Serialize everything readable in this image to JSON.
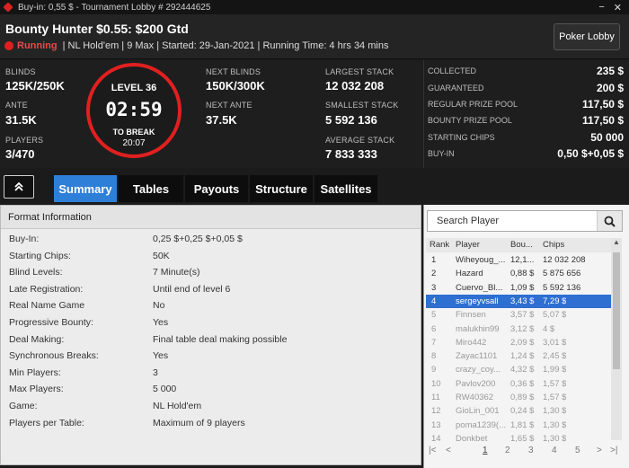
{
  "window": {
    "title": "Buy-in: 0,55 $ - Tournament Lobby # 292444625",
    "controls": [
      "−",
      "✕"
    ]
  },
  "header": {
    "tournament_name": "Bounty Hunter $0.55: $200 Gtd",
    "status": "Running",
    "details": "| NL Hold'em | 9 Max | Started: 29-Jan-2021 | Running Time: 4 hrs  34 mins",
    "lobby_button": "Poker Lobby"
  },
  "stats": {
    "blinds_label": "BLINDS",
    "blinds": "125K/250K",
    "ante_label": "ANTE",
    "ante": "31.5K",
    "players_label": "PLAYERS",
    "players": "3/470",
    "next_blinds_label": "NEXT BLINDS",
    "next_blinds": "150K/300K",
    "next_ante_label": "NEXT ANTE",
    "next_ante": "37.5K",
    "largest_stack_label": "LARGEST STACK",
    "largest_stack": "12 032 208",
    "smallest_stack_label": "SMALLEST STACK",
    "smallest_stack": "5 592 136",
    "average_stack_label": "AVERAGE STACK",
    "average_stack": "7 833 333"
  },
  "clock": {
    "level": "LEVEL 36",
    "time": "02:59",
    "to_break_label": "TO BREAK",
    "to_break": "20:07"
  },
  "prize": [
    {
      "label": "COLLECTED",
      "value": "235 $"
    },
    {
      "label": "GUARANTEED",
      "value": "200 $"
    },
    {
      "label": "REGULAR PRIZE POOL",
      "value": "117,50 $"
    },
    {
      "label": "BOUNTY PRIZE POOL",
      "value": "117,50 $"
    },
    {
      "label": "STARTING CHIPS",
      "value": "50 000"
    },
    {
      "label": "BUY-IN",
      "value": "0,50 $+0,05 $"
    }
  ],
  "tabs": [
    {
      "label": "Summary",
      "active": true
    },
    {
      "label": "Tables"
    },
    {
      "label": "Payouts"
    },
    {
      "label": "Structure"
    },
    {
      "label": "Satellites"
    }
  ],
  "format": {
    "heading": "Format Information",
    "rows": [
      {
        "label": "Buy-In:",
        "value": "0,25 $+0,25 $+0,05 $"
      },
      {
        "label": "Starting Chips:",
        "value": "50K"
      },
      {
        "label": "Blind Levels:",
        "value": "7 Minute(s)"
      },
      {
        "label": "Late Registration:",
        "value": "Until end of level 6"
      },
      {
        "label": "Real Name Game",
        "value": "No"
      },
      {
        "label": "Progressive Bounty:",
        "value": "Yes"
      },
      {
        "label": "Deal Making:",
        "value": "Final table deal making possible"
      },
      {
        "label": "Synchronous Breaks:",
        "value": "Yes"
      },
      {
        "label": "Min Players:",
        "value": "3"
      },
      {
        "label": "Max Players:",
        "value": "5 000"
      },
      {
        "label": "Game:",
        "value": "NL Hold'em"
      },
      {
        "label": "Players per Table:",
        "value": "Maximum of 9 players"
      }
    ]
  },
  "players": {
    "search_placeholder": "Search Player",
    "columns": [
      "Rank",
      "Player",
      "Bou...",
      "Chips"
    ],
    "rows": [
      {
        "rank": "1",
        "player": "Wiheyoug_...",
        "bounty": "12,1...",
        "chips": "12 032 208",
        "state": "normal"
      },
      {
        "rank": "2",
        "player": "Hazard",
        "bounty": "0,88 $",
        "chips": "5 875 656",
        "state": "normal"
      },
      {
        "rank": "3",
        "player": "Cuervo_Bl...",
        "bounty": "1,09 $",
        "chips": "5 592 136",
        "state": "normal"
      },
      {
        "rank": "4",
        "player": "sergeyvsall",
        "bounty": "3,43 $",
        "chips": "7,29 $",
        "state": "selected"
      },
      {
        "rank": "5",
        "player": "Finnsen",
        "bounty": "3,57 $",
        "chips": "5,07 $",
        "state": "dim"
      },
      {
        "rank": "6",
        "player": "malukhin99",
        "bounty": "3,12 $",
        "chips": "4 $",
        "state": "dim"
      },
      {
        "rank": "7",
        "player": "Miro442",
        "bounty": "2,09 $",
        "chips": "3,01 $",
        "state": "dim"
      },
      {
        "rank": "8",
        "player": "Zayac1101",
        "bounty": "1,24 $",
        "chips": "2,45 $",
        "state": "dim"
      },
      {
        "rank": "9",
        "player": "crazy_coy...",
        "bounty": "4,32 $",
        "chips": "1,99 $",
        "state": "dim"
      },
      {
        "rank": "10",
        "player": "Pavlov200",
        "bounty": "0,36 $",
        "chips": "1,57 $",
        "state": "dim"
      },
      {
        "rank": "11",
        "player": "RW40362",
        "bounty": "0,89 $",
        "chips": "1,57 $",
        "state": "dim"
      },
      {
        "rank": "12",
        "player": "GioLin_001",
        "bounty": "0,24 $",
        "chips": "1,30 $",
        "state": "dim"
      },
      {
        "rank": "13",
        "player": "poma1239(...",
        "bounty": "1,81 $",
        "chips": "1,30 $",
        "state": "dim"
      },
      {
        "rank": "14",
        "player": "Donkbet",
        "bounty": "1,65 $",
        "chips": "1,30 $",
        "state": "dim"
      }
    ],
    "pager": {
      "first": "|<",
      "prev": "<",
      "pages": [
        "1",
        "2",
        "3",
        "4",
        "5"
      ],
      "current": "1",
      "next": ">",
      "last": ">|"
    }
  }
}
